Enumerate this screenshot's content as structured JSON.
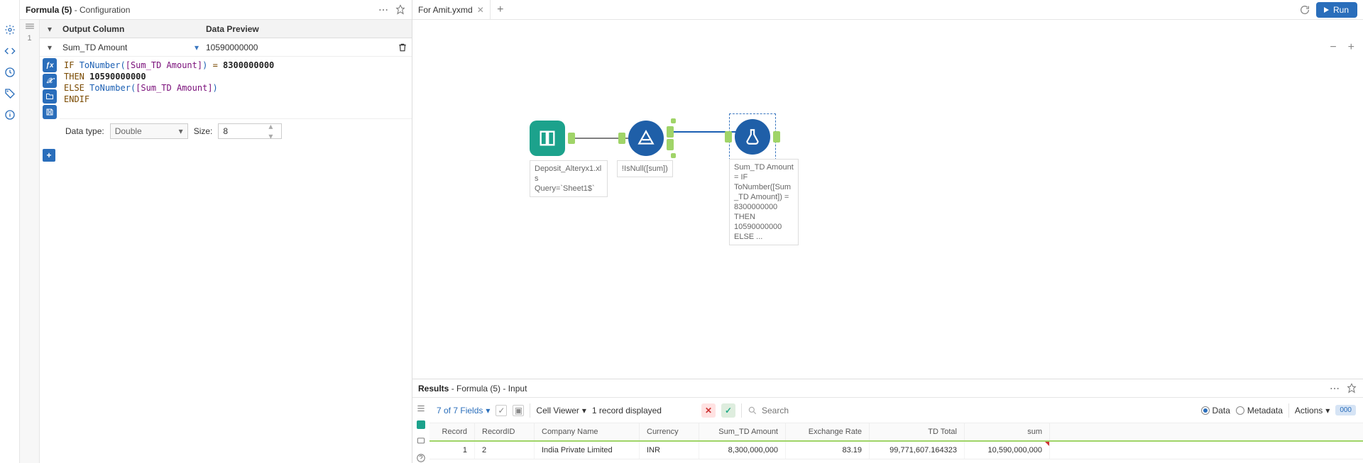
{
  "config": {
    "header": {
      "tool": "Formula (5)",
      "suffix": "- Configuration"
    },
    "grid_headers": {
      "output": "Output Column",
      "preview": "Data Preview"
    },
    "row": {
      "output_field": "Sum_TD Amount",
      "preview_value": "10590000000"
    },
    "formula": {
      "line1_if": "IF",
      "line1_fn": "ToNumber",
      "line1_field": "[Sum_TD Amount]",
      "line1_eq": "=",
      "line1_num": "8300000000",
      "line2_then": "THEN",
      "line2_val": "10590000000",
      "line3_else": "ELSE",
      "line3_fn": "ToNumber",
      "line3_field": "[Sum_TD Amount]",
      "line4_endif": "ENDIF"
    },
    "datatype_label": "Data type:",
    "datatype_value": "Double",
    "size_label": "Size:",
    "size_value": "8"
  },
  "tabs": {
    "active": "For Amit.yxmd",
    "run": "Run"
  },
  "nodes": {
    "input_label": "Deposit_Alteryx1.xls\nQuery=`Sheet1$`",
    "filter_label": "!IsNull([sum])",
    "formula_label": "Sum_TD Amount = IF ToNumber([Sum_TD Amount]) = 8300000000 THEN 10590000000 ELSE ..."
  },
  "results": {
    "header": {
      "title": "Results",
      "suffix": "- Formula (5) - Input"
    },
    "toolbar": {
      "field_count": "7 of 7 Fields",
      "cell_viewer": "Cell Viewer",
      "record_disp": "1 record displayed",
      "search_placeholder": "Search",
      "data_label": "Data",
      "metadata_label": "Metadata",
      "actions_label": "Actions",
      "badge": "000"
    },
    "columns": [
      "Record",
      "RecordID",
      "Company Name",
      "Currency",
      "Sum_TD Amount",
      "Exchange Rate",
      "TD Total",
      "sum"
    ],
    "row": {
      "record": "1",
      "recordid": "2",
      "company": "India Private Limited",
      "currency": "INR",
      "sumtd": "8,300,000,000",
      "exchange": "83.19",
      "tdtotal": "99,771,607.164323",
      "sum": "10,590,000,000"
    }
  },
  "chart_data": {
    "type": "table",
    "title": "Results - Formula (5) - Input",
    "columns": [
      "Record",
      "RecordID",
      "Company Name",
      "Currency",
      "Sum_TD Amount",
      "Exchange Rate",
      "TD Total",
      "sum"
    ],
    "rows": [
      [
        1,
        2,
        "India Private Limited",
        "INR",
        8300000000,
        83.19,
        99771607.164323,
        10590000000
      ]
    ]
  }
}
